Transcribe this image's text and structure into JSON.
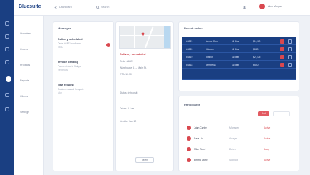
{
  "app": {
    "brand": "Bluesuite",
    "accent": "#1a3f82",
    "alert_color": "#d9484f"
  },
  "topbar": {
    "links": [
      {
        "label": "Dashboard",
        "icon": "back-arrow-icon"
      },
      {
        "label": "Search",
        "icon": "search-icon"
      }
    ],
    "bell_icon": "bell-icon",
    "user": {
      "name": "Alex Morgan",
      "avatar": "avatar-icon"
    }
  },
  "sidebar": {
    "items": [
      {
        "label": "Overview"
      },
      {
        "label": "Orders"
      },
      {
        "label": "Products"
      },
      {
        "label": "Reports"
      },
      {
        "label": "Clients"
      },
      {
        "label": "Settings"
      }
    ],
    "active_index": 3
  },
  "inbox": {
    "title": "Messages",
    "items": [
      {
        "title": "Delivery scheduled",
        "sub": "Order #4821 confirmed",
        "time": "08:42"
      },
      {
        "title": "Invoice pending",
        "sub": "Payment due in 3 days",
        "time": "Yesterday"
      },
      {
        "title": "New request",
        "sub": "Customer asked for quote",
        "time": "Mon"
      }
    ]
  },
  "detail": {
    "title": "Delivery scheduled",
    "lines": [
      "Order #4821",
      "Warehouse A → Main St.",
      "ETA: 10:30",
      "Status: In transit",
      "Driver: J. Lee",
      "Vehicle: Van 12"
    ],
    "button": "Open"
  },
  "orders": {
    "title": "Recent orders",
    "rows": [
      {
        "id": "#4821",
        "client": "Acme Corp",
        "date": "12 Mar",
        "amount": "$1,240"
      },
      {
        "id": "#4820",
        "client": "Globex",
        "date": "12 Mar",
        "amount": "$860"
      },
      {
        "id": "#4819",
        "client": "Initech",
        "date": "11 Mar",
        "amount": "$2,105"
      },
      {
        "id": "#4818",
        "client": "Umbrella",
        "date": "11 Mar",
        "amount": "$540"
      }
    ]
  },
  "participants": {
    "title": "Participants",
    "action": "Add",
    "rows": [
      {
        "name": "John Carter",
        "role": "Manager",
        "state": "Active"
      },
      {
        "name": "Sara Lin",
        "role": "Analyst",
        "state": "Active"
      },
      {
        "name": "Mike Reed",
        "role": "Driver",
        "state": "Away"
      },
      {
        "name": "Emma Stone",
        "role": "Support",
        "state": "Active"
      }
    ]
  }
}
